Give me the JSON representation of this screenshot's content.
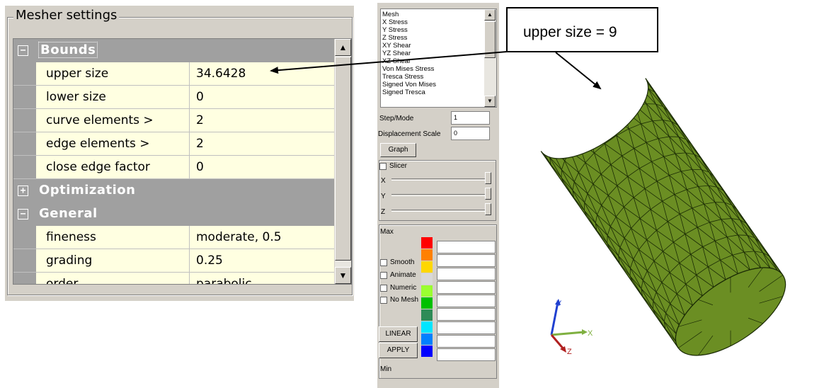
{
  "mesher": {
    "title": "Mesher settings",
    "categories": {
      "bounds": {
        "label": "Bounds",
        "expander": "−"
      },
      "optimization": {
        "label": "Optimization",
        "expander": "+"
      },
      "general": {
        "label": "General",
        "expander": "−"
      }
    },
    "properties": [
      {
        "name": "upper size",
        "value": "34.6428"
      },
      {
        "name": "lower size",
        "value": "0"
      },
      {
        "name": "curve elements >",
        "value": "2"
      },
      {
        "name": "edge elements >",
        "value": "2"
      },
      {
        "name": "close edge factor",
        "value": "0"
      },
      {
        "name": "fineness",
        "value": "moderate, 0.5"
      },
      {
        "name": "grading",
        "value": "0.25"
      },
      {
        "name": "order",
        "value": "parabolic"
      }
    ]
  },
  "results_panel": {
    "field_list": [
      "Mesh",
      "X Stress",
      "Y Stress",
      "Z Stress",
      "XY Shear",
      "YZ Shear",
      "XZ Shear",
      "Von Mises Stress",
      "Tresca Stress",
      "Signed Von Mises",
      "Signed Tresca"
    ],
    "step_mode_label": "Step/Mode",
    "step_mode_value": "1",
    "displacement_scale_label": "Displacement Scale",
    "displacement_scale_value": "0",
    "graph_button": "Graph",
    "slicer_label": "Slicer",
    "slicer_axes": [
      "X",
      "Y",
      "Z"
    ],
    "max_label": "Max",
    "min_label": "Min",
    "options": [
      "Smooth",
      "Animate",
      "Numeric",
      "No Mesh"
    ],
    "linear_button": "LINEAR",
    "apply_button": "APPLY",
    "legend_colors": [
      "#ff0000",
      "#ff8000",
      "#ffd700",
      "#d8d8d8",
      "#9aff30",
      "#00c000",
      "#2e8b57",
      "#00e5ff",
      "#0080ff",
      "#0000ff"
    ]
  },
  "annotation": {
    "text": "upper size = 9"
  },
  "viewport": {
    "mesh_color": "#6b8e23",
    "mesh_line_color": "#1a2a05",
    "axis_labels": {
      "x": "X",
      "y": "Y",
      "z": "Z"
    },
    "axis_colors": {
      "x": "#7fb040",
      "y": "#2040d0",
      "z": "#b02020"
    }
  }
}
